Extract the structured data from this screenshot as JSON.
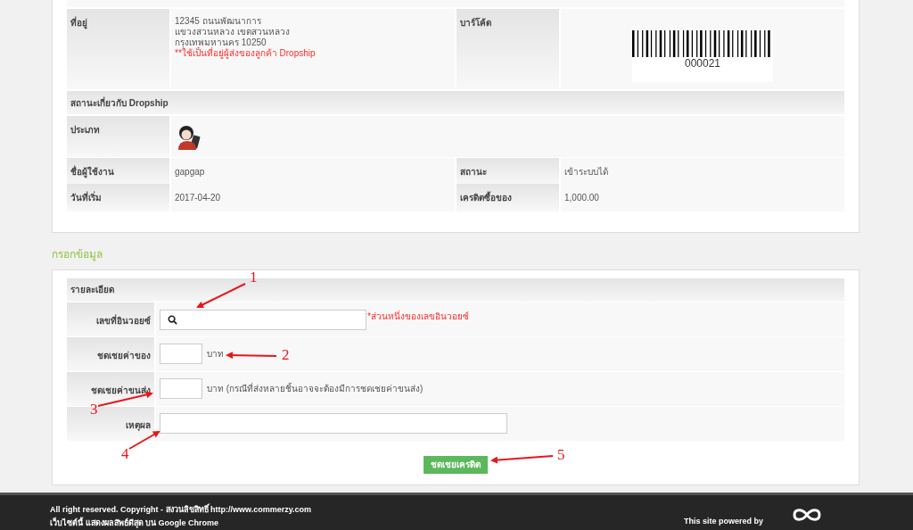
{
  "customer": {
    "rows": [
      {
        "kind": "address",
        "label": "ที่อยู่",
        "lines": [
          "12345 ถนนพัฒนาการ",
          "แขวงสวนหลวง เขตสวนหลวง",
          "กรุงเทพมหานคร 10250"
        ],
        "note": "**ใช้เป็นที่อยู่ผู้ส่งของลูกค้า Dropship",
        "label_2": "บาร์โค้ด",
        "barcode": "000021"
      },
      {
        "kind": "section",
        "label": "สถานะเกี่ยวกับ Dropship"
      },
      {
        "kind": "avatar",
        "label": "ประเภท"
      },
      {
        "kind": "pair",
        "label": "ชื่อผู้ใช้งาน",
        "value": "gapgap",
        "label_2": "สถานะ",
        "value_2": "เข้าระบบได้"
      },
      {
        "kind": "pair",
        "label": "วันที่เริ่ม",
        "value": "2017-04-20",
        "label_2": "เครดิตซื้อของ",
        "value_2": "1,000.00"
      }
    ]
  },
  "form": {
    "heading": "กรอกข้อมูล",
    "header": "รายละเอียด",
    "rows": [
      {
        "kind": "search",
        "label": "เลขที่อินวอยซ์",
        "note": "*ส่วนหนึ่งของเลขอินวอยซ์"
      },
      {
        "kind": "amount",
        "label": "ชดเชยค่าของ",
        "unit": "บาท"
      },
      {
        "kind": "amount",
        "label": "ชดเชยค่าขนส่ง",
        "unit": "บาท (กรณีที่ส่งหลายชิ้นอาจจะต้องมีการชดเชยค่าขนส่ง)"
      },
      {
        "kind": "text",
        "label": "เหตุผล"
      }
    ],
    "button": "ชดเชยเครดิต"
  },
  "annotations": [
    "1",
    "2",
    "3",
    "4",
    "5"
  ],
  "footer": {
    "lines": [
      "All right reserved. Copyright - สงวนลิขสิทธิ์ http://www.commerzy.com",
      "เว็บไซต์นี้ แสดงผลสัพธ์ดีสุด บน Google Chrome"
    ],
    "powered": "This site powered by"
  }
}
